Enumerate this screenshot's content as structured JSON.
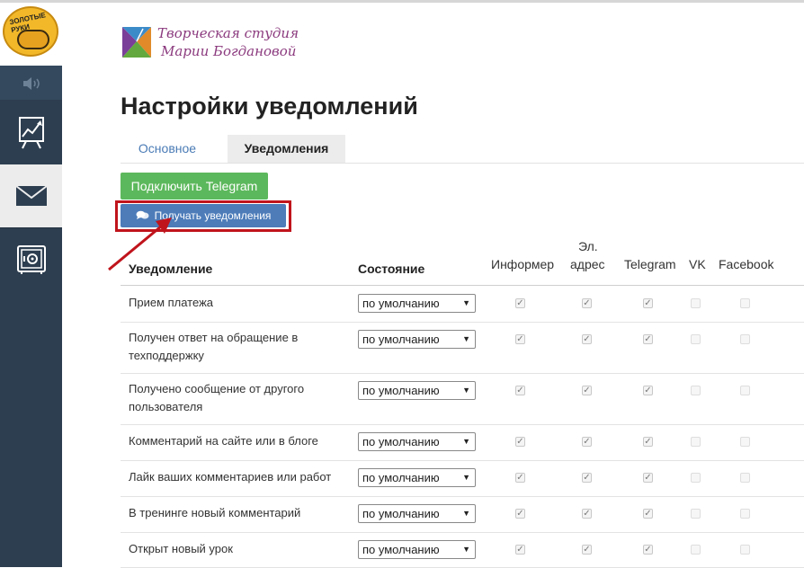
{
  "sidebar": {
    "logo_text": "ЗОЛОТЫЕ РУКИ",
    "items": [
      {
        "icon": "speaker-icon"
      },
      {
        "icon": "chart-icon"
      },
      {
        "icon": "mail-icon",
        "active": true
      },
      {
        "icon": "safe-icon"
      }
    ]
  },
  "brand": {
    "line1": "Творческая студия",
    "line2": "Марии Богдановой"
  },
  "page_title": "Настройки уведомлений",
  "tabs": [
    {
      "label": "Основное",
      "active": false
    },
    {
      "label": "Уведомления",
      "active": true
    }
  ],
  "buttons": {
    "connect_telegram": "Подключить Telegram",
    "get_notifications": "Получать уведомления"
  },
  "table": {
    "headers": {
      "notification": "Уведомление",
      "state": "Состояние",
      "informer": "Информер",
      "email_line1": "Эл.",
      "email_line2": "адрес",
      "telegram": "Telegram",
      "vk": "VK",
      "facebook": "Facebook"
    },
    "rows": [
      {
        "name": "Прием платежа",
        "state": "по умолчанию"
      },
      {
        "name": "Получен ответ на обращение в техподдержку",
        "state": "по умолчанию"
      },
      {
        "name": "Получено сообщение от другого пользователя",
        "state": "по умолчанию"
      },
      {
        "name": "Комментарий на сайте или в блоге",
        "state": "по умолчанию"
      },
      {
        "name": "Лайк ваших комментариев или работ",
        "state": "по умолчанию"
      },
      {
        "name": "В тренинге новый комментарий",
        "state": "по умолчанию"
      },
      {
        "name": "Открыт новый урок",
        "state": "по умолчанию"
      }
    ],
    "checked_columns": [
      "informer",
      "email",
      "telegram"
    ],
    "disabled_columns": [
      "vk",
      "facebook"
    ]
  },
  "colors": {
    "sidebar": "#2d3e50",
    "green_button": "#5cb85c",
    "blue_button": "#4d7cb9",
    "highlight": "#c0141c",
    "tab_link": "#4a7bb5"
  }
}
